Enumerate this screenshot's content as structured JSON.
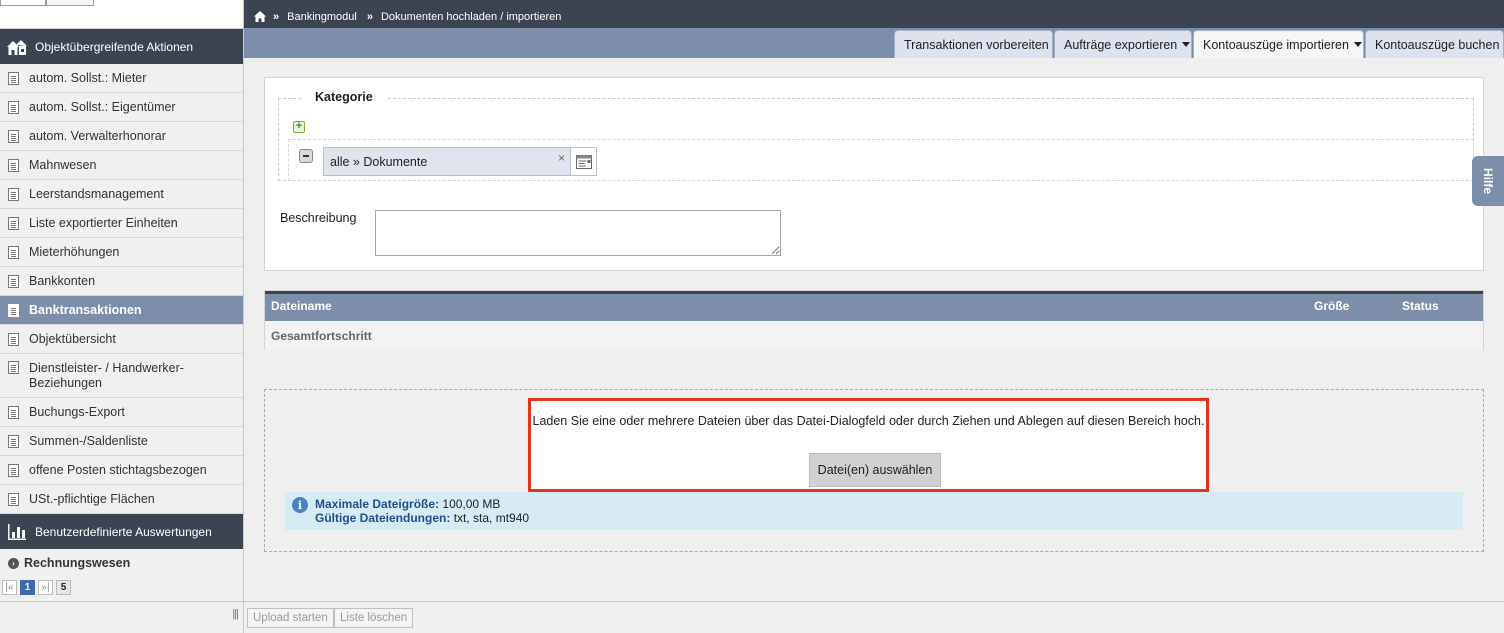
{
  "sidebar": {
    "header": "Objektübergreifende Aktionen",
    "items": [
      {
        "label": "autom. Sollst.: Mieter"
      },
      {
        "label": "autom. Sollst.: Eigentümer"
      },
      {
        "label": "autom. Verwalterhonorar"
      },
      {
        "label": "Mahnwesen"
      },
      {
        "label": "Leerstandsmanagement"
      },
      {
        "label": "Liste exportierter Einheiten"
      },
      {
        "label": "Mieterhöhungen"
      },
      {
        "label": "Bankkonten"
      },
      {
        "label": "Banktransaktionen",
        "active": true
      },
      {
        "label": "Objektübersicht"
      },
      {
        "label": "Dienstleister- / Handwerker-Beziehungen"
      },
      {
        "label": "Buchungs-Export"
      },
      {
        "label": "Summen-/Saldenliste"
      },
      {
        "label": "offene Posten stichtagsbezogen"
      },
      {
        "label": "USt.-pflichtige Flächen"
      }
    ],
    "header2": "Benutzerdefinierte Auswertungen",
    "section": "Rechnungswesen",
    "pager": {
      "first": "|«",
      "current": "1",
      "last": "»|",
      "total": "5"
    },
    "grip": "|||"
  },
  "breadcrumb": {
    "module": "Bankingmodul",
    "page": "Dokumenten hochladen / importieren",
    "separator": "»"
  },
  "tabs": [
    {
      "label": "Transaktionen vorbereiten"
    },
    {
      "label": "Aufträge exportieren",
      "dropdown": true
    },
    {
      "label": "Kontoauszüge importieren",
      "dropdown": true,
      "active": true
    },
    {
      "label": "Kontoauszüge buchen"
    }
  ],
  "form": {
    "legend": "Kategorie",
    "add": "+",
    "category_value": "alle » Dokumente",
    "clear": "×",
    "description_label": "Beschreibung",
    "description_value": ""
  },
  "table": {
    "columns": [
      "Dateiname",
      "Größe",
      "Status"
    ],
    "total_label": "Gesamtfortschritt"
  },
  "dropzone": {
    "text": "Laden Sie eine oder mehrere Dateien über das Datei-Dialogfeld oder durch Ziehen und Ablegen auf diesen Bereich hoch.",
    "button": "Datei(en) auswählen",
    "max_size_label": "Maximale Dateigröße:",
    "max_size_value": "100,00 MB",
    "extensions_label": "Gültige Dateiendungen:",
    "extensions_value": "txt, sta, mt940",
    "info_icon": "i"
  },
  "help": "Hilfe",
  "footer": {
    "start_upload": "Upload starten",
    "clear_list": "Liste löschen"
  },
  "colors": {
    "dark_header": "#3c4452",
    "accent": "#7d8eab",
    "highlight_border": "#e8321e",
    "info_bg": "#d7ebf5"
  }
}
